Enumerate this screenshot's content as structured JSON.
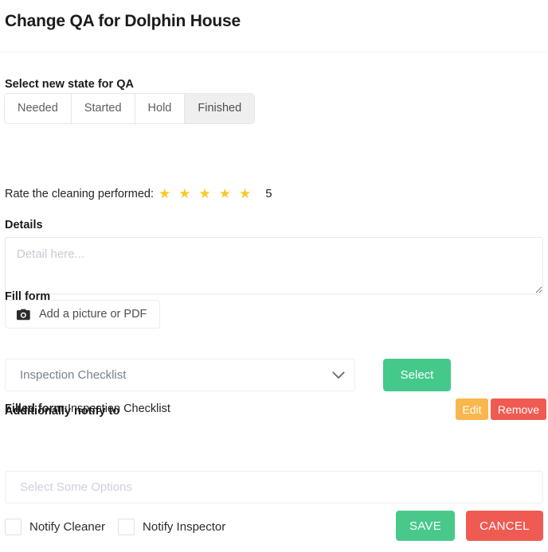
{
  "header": {
    "title": "Change QA for Dolphin House"
  },
  "state_section": {
    "label": "Select new state for QA",
    "options": [
      {
        "label": "Needed",
        "active": false
      },
      {
        "label": "Started",
        "active": false
      },
      {
        "label": "Hold",
        "active": false
      },
      {
        "label": "Finished",
        "active": true
      }
    ],
    "selected": "Finished"
  },
  "rating": {
    "label": "Rate the cleaning performed:",
    "value": "5",
    "max": 5,
    "filled": 5,
    "star_glyph": "★",
    "star_color": "#f9c92e"
  },
  "details": {
    "label": "Details",
    "value": "",
    "placeholder": "Detail here..."
  },
  "attachment": {
    "button_label": "Add a picture or PDF",
    "icon": "camera-icon"
  },
  "fill_form": {
    "label": "Fill form",
    "select_value": "Inspection Checklist",
    "select_icon": "chevron-down-icon",
    "select_button_label": "Select",
    "filled_label": "Filled form:",
    "filled_value": "Inspection Checklist",
    "edit_label": "Edit",
    "remove_label": "Remove"
  },
  "notify": {
    "label": "Additionally notify to",
    "multiselect_value": "",
    "multiselect_placeholder": "Select Some Options",
    "checkboxes": [
      {
        "label": "Notify Cleaner",
        "checked": false
      },
      {
        "label": "Notify Inspector",
        "checked": false
      }
    ]
  },
  "footer": {
    "save_label": "SAVE",
    "cancel_label": "CANCEL"
  },
  "colors": {
    "green": "#44c98a",
    "red": "#ef5b52",
    "orange": "#f9b64d",
    "star": "#f9c92e",
    "text": "#212529",
    "muted": "#78808f",
    "placeholder": "#cfd0dd"
  }
}
